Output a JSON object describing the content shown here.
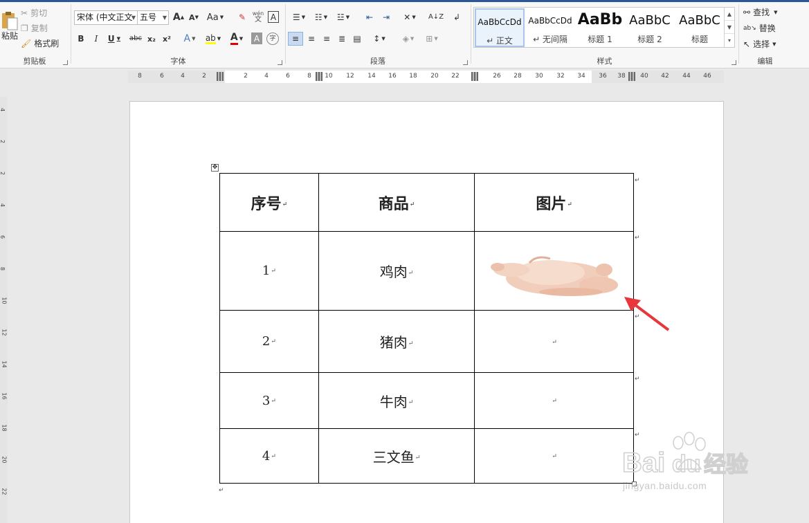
{
  "clipboard": {
    "paste_label": "粘贴",
    "cut_label": "剪切",
    "copy_label": "复制",
    "format_painter_label": "格式刷",
    "group_label": "剪贴板"
  },
  "font": {
    "font_name": "宋体 (中文正文",
    "font_size": "五号",
    "grow_label": "A",
    "shrink_label": "A",
    "case_label": "Aa",
    "phonetic_label": "wén",
    "bold_label": "B",
    "italic_label": "I",
    "underline_label": "U",
    "strike_label": "abc",
    "subscript_label": "x₂",
    "superscript_label": "x²",
    "group_label": "字体"
  },
  "paragraph": {
    "group_label": "段落"
  },
  "styles": {
    "group_label": "样式",
    "items": [
      {
        "preview": "AaBbCcDd",
        "name": "↵ 正文"
      },
      {
        "preview": "AaBbCcDd",
        "name": "↵ 无间隔"
      },
      {
        "preview": "AaBb",
        "name": "标题 1"
      },
      {
        "preview": "AaBbC",
        "name": "标题 2"
      },
      {
        "preview": "AaBbC",
        "name": "标题"
      }
    ]
  },
  "editing": {
    "find_label": "查找",
    "replace_label": "替换",
    "select_label": "选择",
    "group_label": "编辑"
  },
  "ruler": {
    "ticks": [
      "8",
      "6",
      "4",
      "2",
      "2",
      "4",
      "6",
      "8",
      "10",
      "12",
      "14",
      "16",
      "18",
      "20",
      "22",
      "26",
      "28",
      "30",
      "32",
      "34",
      "36",
      "38",
      "40",
      "42",
      "44",
      "46"
    ],
    "vticks": [
      "4",
      "2",
      "2",
      "4",
      "6",
      "8",
      "10",
      "12",
      "14",
      "16",
      "18",
      "20",
      "22"
    ]
  },
  "table": {
    "headers": [
      "序号",
      "商品",
      "图片"
    ],
    "rows": [
      {
        "no": "1",
        "item": "鸡肉"
      },
      {
        "no": "2",
        "item": "猪肉"
      },
      {
        "no": "3",
        "item": "牛肉"
      },
      {
        "no": "4",
        "item": "三文鱼"
      }
    ],
    "image_name": "chicken-image"
  },
  "marks": {
    "paragraph": "↵",
    "move": "✥"
  },
  "watermark": {
    "brand": "Bai",
    "brand2": "du",
    "cn": "经验",
    "url": "jingyan.baidu.com"
  },
  "colors": {
    "accent": "#2b579a",
    "arrow": "#e8373c",
    "font_red": "#e00000"
  }
}
